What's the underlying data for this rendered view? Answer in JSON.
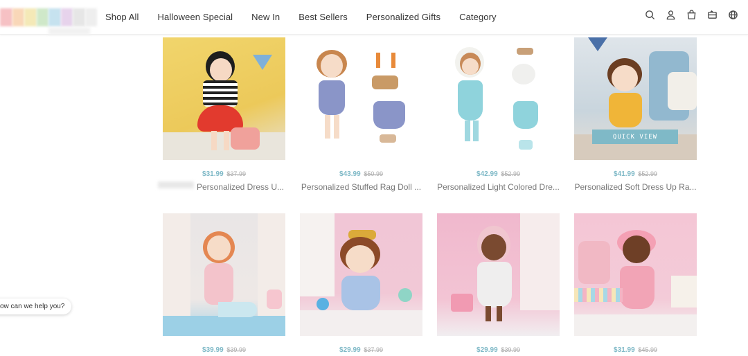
{
  "header": {
    "nav": [
      "Shop All",
      "Halloween Special",
      "New In",
      "Best Sellers",
      "Personalized Gifts",
      "Category"
    ],
    "icons": [
      "search-icon",
      "account-icon",
      "cart-icon",
      "gift-card-icon",
      "globe-icon"
    ]
  },
  "quick_view_label": "QUICK VIEW",
  "chat_label": "ow can we help you?",
  "products": [
    {
      "price": "$31.99",
      "old_price": "$37.99",
      "title": "Personalized Dress U..."
    },
    {
      "price": "$43.99",
      "old_price": "$50.99",
      "title": "Personalized Stuffed Rag Doll ..."
    },
    {
      "price": "$42.99",
      "old_price": "$52.99",
      "title": "Personalized Light Colored Dre..."
    },
    {
      "price": "$41.99",
      "old_price": "$52.99",
      "title": "Personalized Soft Dress Up Ra..."
    },
    {
      "price": "$39.99",
      "old_price": "$39.99",
      "title": ""
    },
    {
      "price": "$29.99",
      "old_price": "$37.99",
      "title": ""
    },
    {
      "price": "$29.99",
      "old_price": "$39.99",
      "title": ""
    },
    {
      "price": "$31.99",
      "old_price": "$45.99",
      "title": ""
    }
  ],
  "colors": {
    "accent": "#7fb9c7"
  }
}
